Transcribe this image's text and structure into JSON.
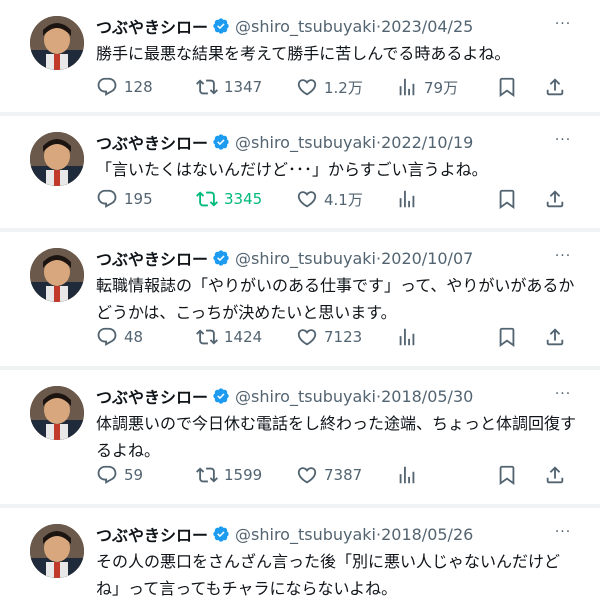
{
  "colors": {
    "text": "#0f1419",
    "muted": "#536471",
    "verified": "#1d9bf0",
    "retweet_active": "#00ba7c",
    "divider": "#eff3f4"
  },
  "icons": [
    "reply-icon",
    "retweet-icon",
    "like-icon",
    "views-icon",
    "bookmark-icon",
    "share-icon",
    "verified-badge-icon",
    "more-icon"
  ],
  "tweets": [
    {
      "name": "つぶやきシロー",
      "handle": "@shiro_tsubuyaki",
      "sep": "·",
      "date": "2023/04/25",
      "more": "···",
      "text": "勝手に最悪な結果を考えて勝手に苦しんでる時あるよね。",
      "replies": "128",
      "retweets": "1347",
      "likes": "1.2万",
      "views": "79万",
      "retweeted": false
    },
    {
      "name": "つぶやきシロー",
      "handle": "@shiro_tsubuyaki",
      "sep": "·",
      "date": "2022/10/19",
      "more": "···",
      "text": "「言いたくはないんだけど･･･」からすごい言うよね。",
      "replies": "195",
      "retweets": "3345",
      "likes": "4.1万",
      "views": "",
      "retweeted": true
    },
    {
      "name": "つぶやきシロー",
      "handle": "@shiro_tsubuyaki",
      "sep": "·",
      "date": "2020/10/07",
      "more": "···",
      "text": "転職情報誌の「やりがいのある仕事です」って、やりがいがあるかどうかは、こっちが決めたいと思います。",
      "replies": "48",
      "retweets": "1424",
      "likes": "7123",
      "views": "",
      "retweeted": false
    },
    {
      "name": "つぶやきシロー",
      "handle": "@shiro_tsubuyaki",
      "sep": "·",
      "date": "2018/05/30",
      "more": "···",
      "text": "体調悪いので今日休む電話をし終わった途端、ちょっと体調回復するよね。",
      "replies": "59",
      "retweets": "1599",
      "likes": "7387",
      "views": "",
      "retweeted": false
    },
    {
      "name": "つぶやきシロー",
      "handle": "@shiro_tsubuyaki",
      "sep": "·",
      "date": "2018/05/26",
      "more": "···",
      "text": "その人の悪口をさんざん言った後「別に悪い人じゃないんだけどね」って言ってもチャラにならないよね。",
      "replies": "",
      "retweets": "",
      "likes": "",
      "views": "",
      "retweeted": false
    }
  ]
}
